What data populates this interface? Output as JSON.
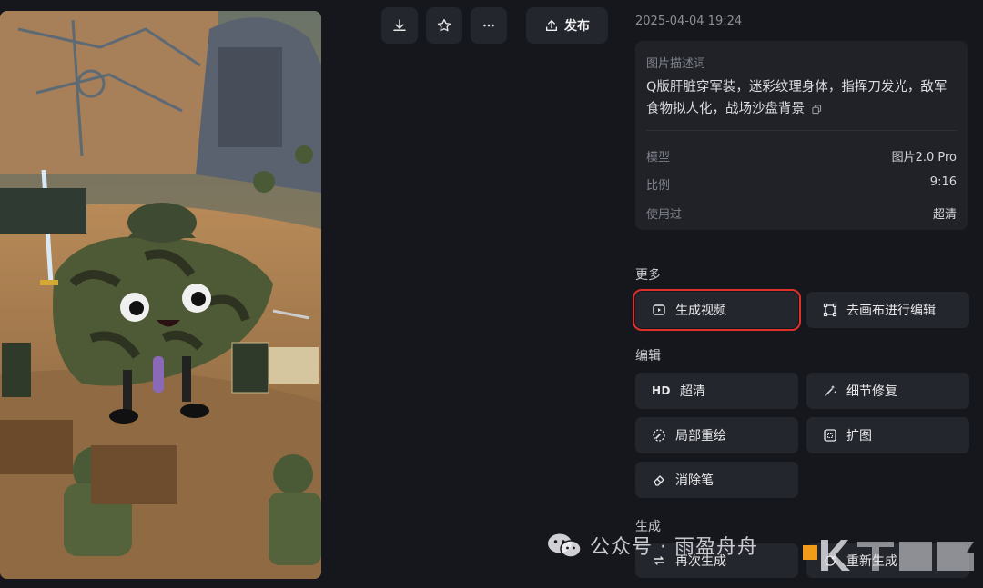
{
  "toolbar": {
    "download_icon": "download-icon",
    "star_icon": "star-icon",
    "more_icon": "more-icon",
    "publish_label": "发布"
  },
  "details": {
    "timestamp": "2025-04-04 19:24",
    "description_label": "图片描述词",
    "description": "Q版肝脏穿军装，迷彩纹理身体，指挥刀发光，敌军食物拟人化，战场沙盘背景",
    "meta": [
      {
        "key": "模型",
        "value": "图片2.0 Pro"
      },
      {
        "key": "比例",
        "value": "9:16"
      },
      {
        "key": "使用过",
        "value": "超清"
      }
    ]
  },
  "sections": {
    "more": "更多",
    "edit": "编辑",
    "generate": "生成"
  },
  "actions": {
    "generate_video": "生成视频",
    "edit_on_canvas": "去画布进行编辑",
    "hd_glyph": "HD",
    "upscale": "超清",
    "detail_fix": "细节修复",
    "inpaint": "局部重绘",
    "expand": "扩图",
    "eraser": "消除笔",
    "regenerate": "再次生成",
    "regenerate2": "重新生成"
  },
  "watermark": {
    "text": "公众号 · 雨盈舟舟"
  },
  "colors": {
    "background": "#16171d",
    "card": "#202228",
    "button": "#24262d",
    "highlight_border": "#e0302a"
  }
}
